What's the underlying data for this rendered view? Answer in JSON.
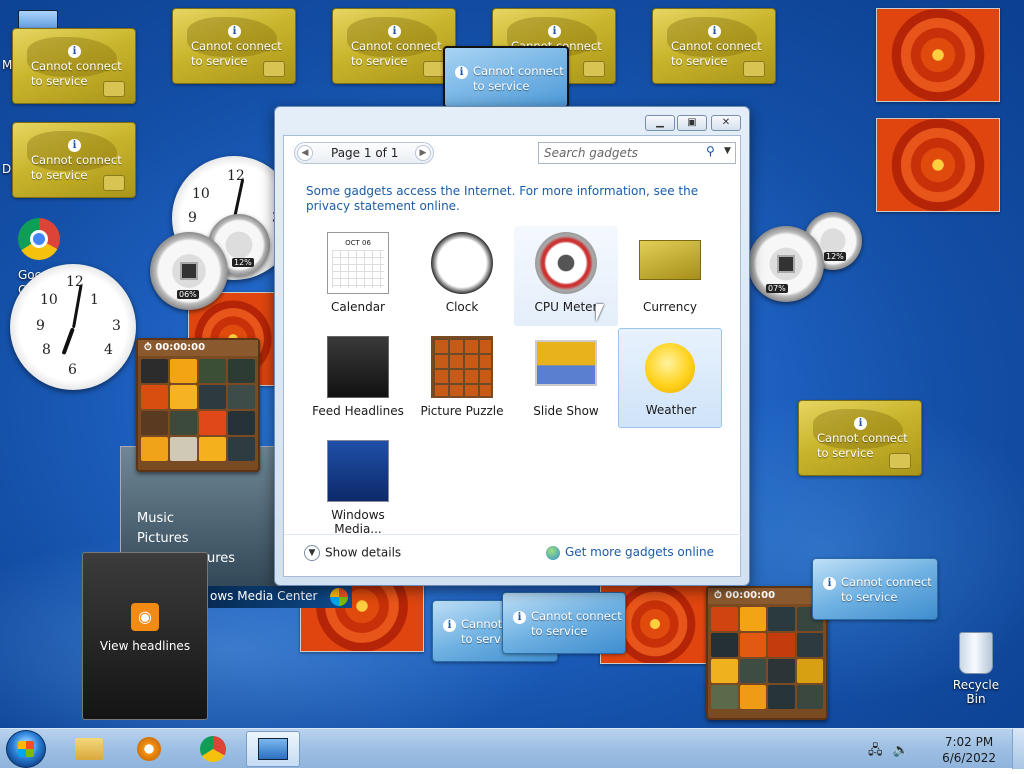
{
  "desktop": {
    "currency_text_1": "Cannot connect",
    "currency_text_2": "to service",
    "meter_left_cpu": "06%",
    "meter_left_mem": "12%",
    "meter_right_cpu": "07%",
    "meter_right_mem": "12%",
    "puzzle_time": "00:00:00",
    "wmc_music": "Music",
    "wmc_pictures": "Pictures",
    "wmc_tures": "ures",
    "wmc_title": "ows Media Center",
    "feed_label": "View headlines",
    "recycle_bin": "Recycle Bin",
    "chrome_label": "Goo",
    "partial_icon_label_m": "M",
    "partial_icon_label_d": "D",
    "partial_icon_label_c": "C"
  },
  "gallery": {
    "page_label": "Page 1 of 1",
    "search_placeholder": "Search gadgets",
    "note": "Some gadgets access the Internet.  For more information, see the privacy statement online.",
    "tiles": [
      {
        "label": "Calendar"
      },
      {
        "label": "Clock"
      },
      {
        "label": "CPU Meter"
      },
      {
        "label": "Currency"
      },
      {
        "label": "Feed Headlines"
      },
      {
        "label": "Picture Puzzle"
      },
      {
        "label": "Slide Show"
      },
      {
        "label": "Weather"
      },
      {
        "label": "Windows Media..."
      }
    ],
    "calendar_month": "OCT 06",
    "show_details": "Show details",
    "get_more": "Get more gadgets online"
  },
  "taskbar": {
    "time": "7:02 PM",
    "date": "6/6/2022"
  }
}
